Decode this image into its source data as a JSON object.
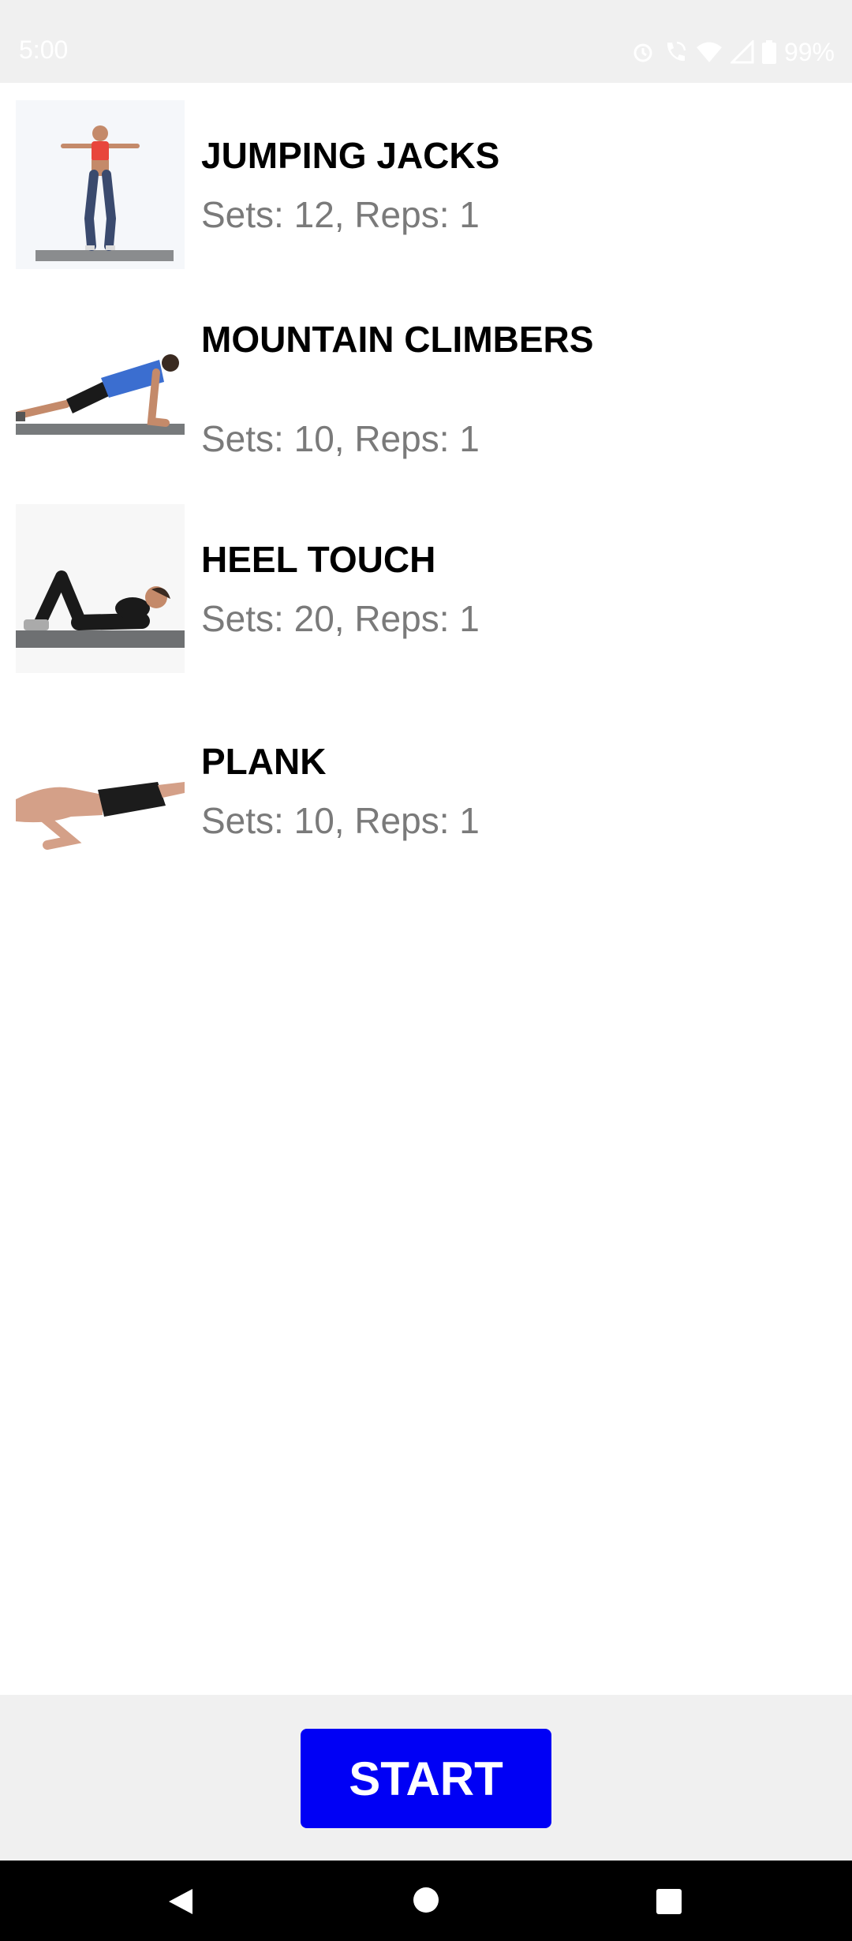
{
  "status_bar": {
    "time": "5:00",
    "battery": "99%",
    "icons": [
      "alarm-icon",
      "wifi-calling-icon",
      "wifi-icon",
      "signal-icon",
      "battery-icon"
    ]
  },
  "exercises": [
    {
      "title": "JUMPING JACKS",
      "detail": "Sets: 12, Reps: 1"
    },
    {
      "title": "MOUNTAIN CLIMBERS",
      "detail": "Sets: 10, Reps: 1"
    },
    {
      "title": "HEEL TOUCH",
      "detail": "Sets: 20, Reps: 1"
    },
    {
      "title": "PLANK",
      "detail": "Sets: 10, Reps: 1"
    }
  ],
  "start_button": {
    "label": "START",
    "color": "#0000f5"
  },
  "nav": {
    "icons": [
      "back-icon",
      "home-icon",
      "recents-icon"
    ]
  }
}
